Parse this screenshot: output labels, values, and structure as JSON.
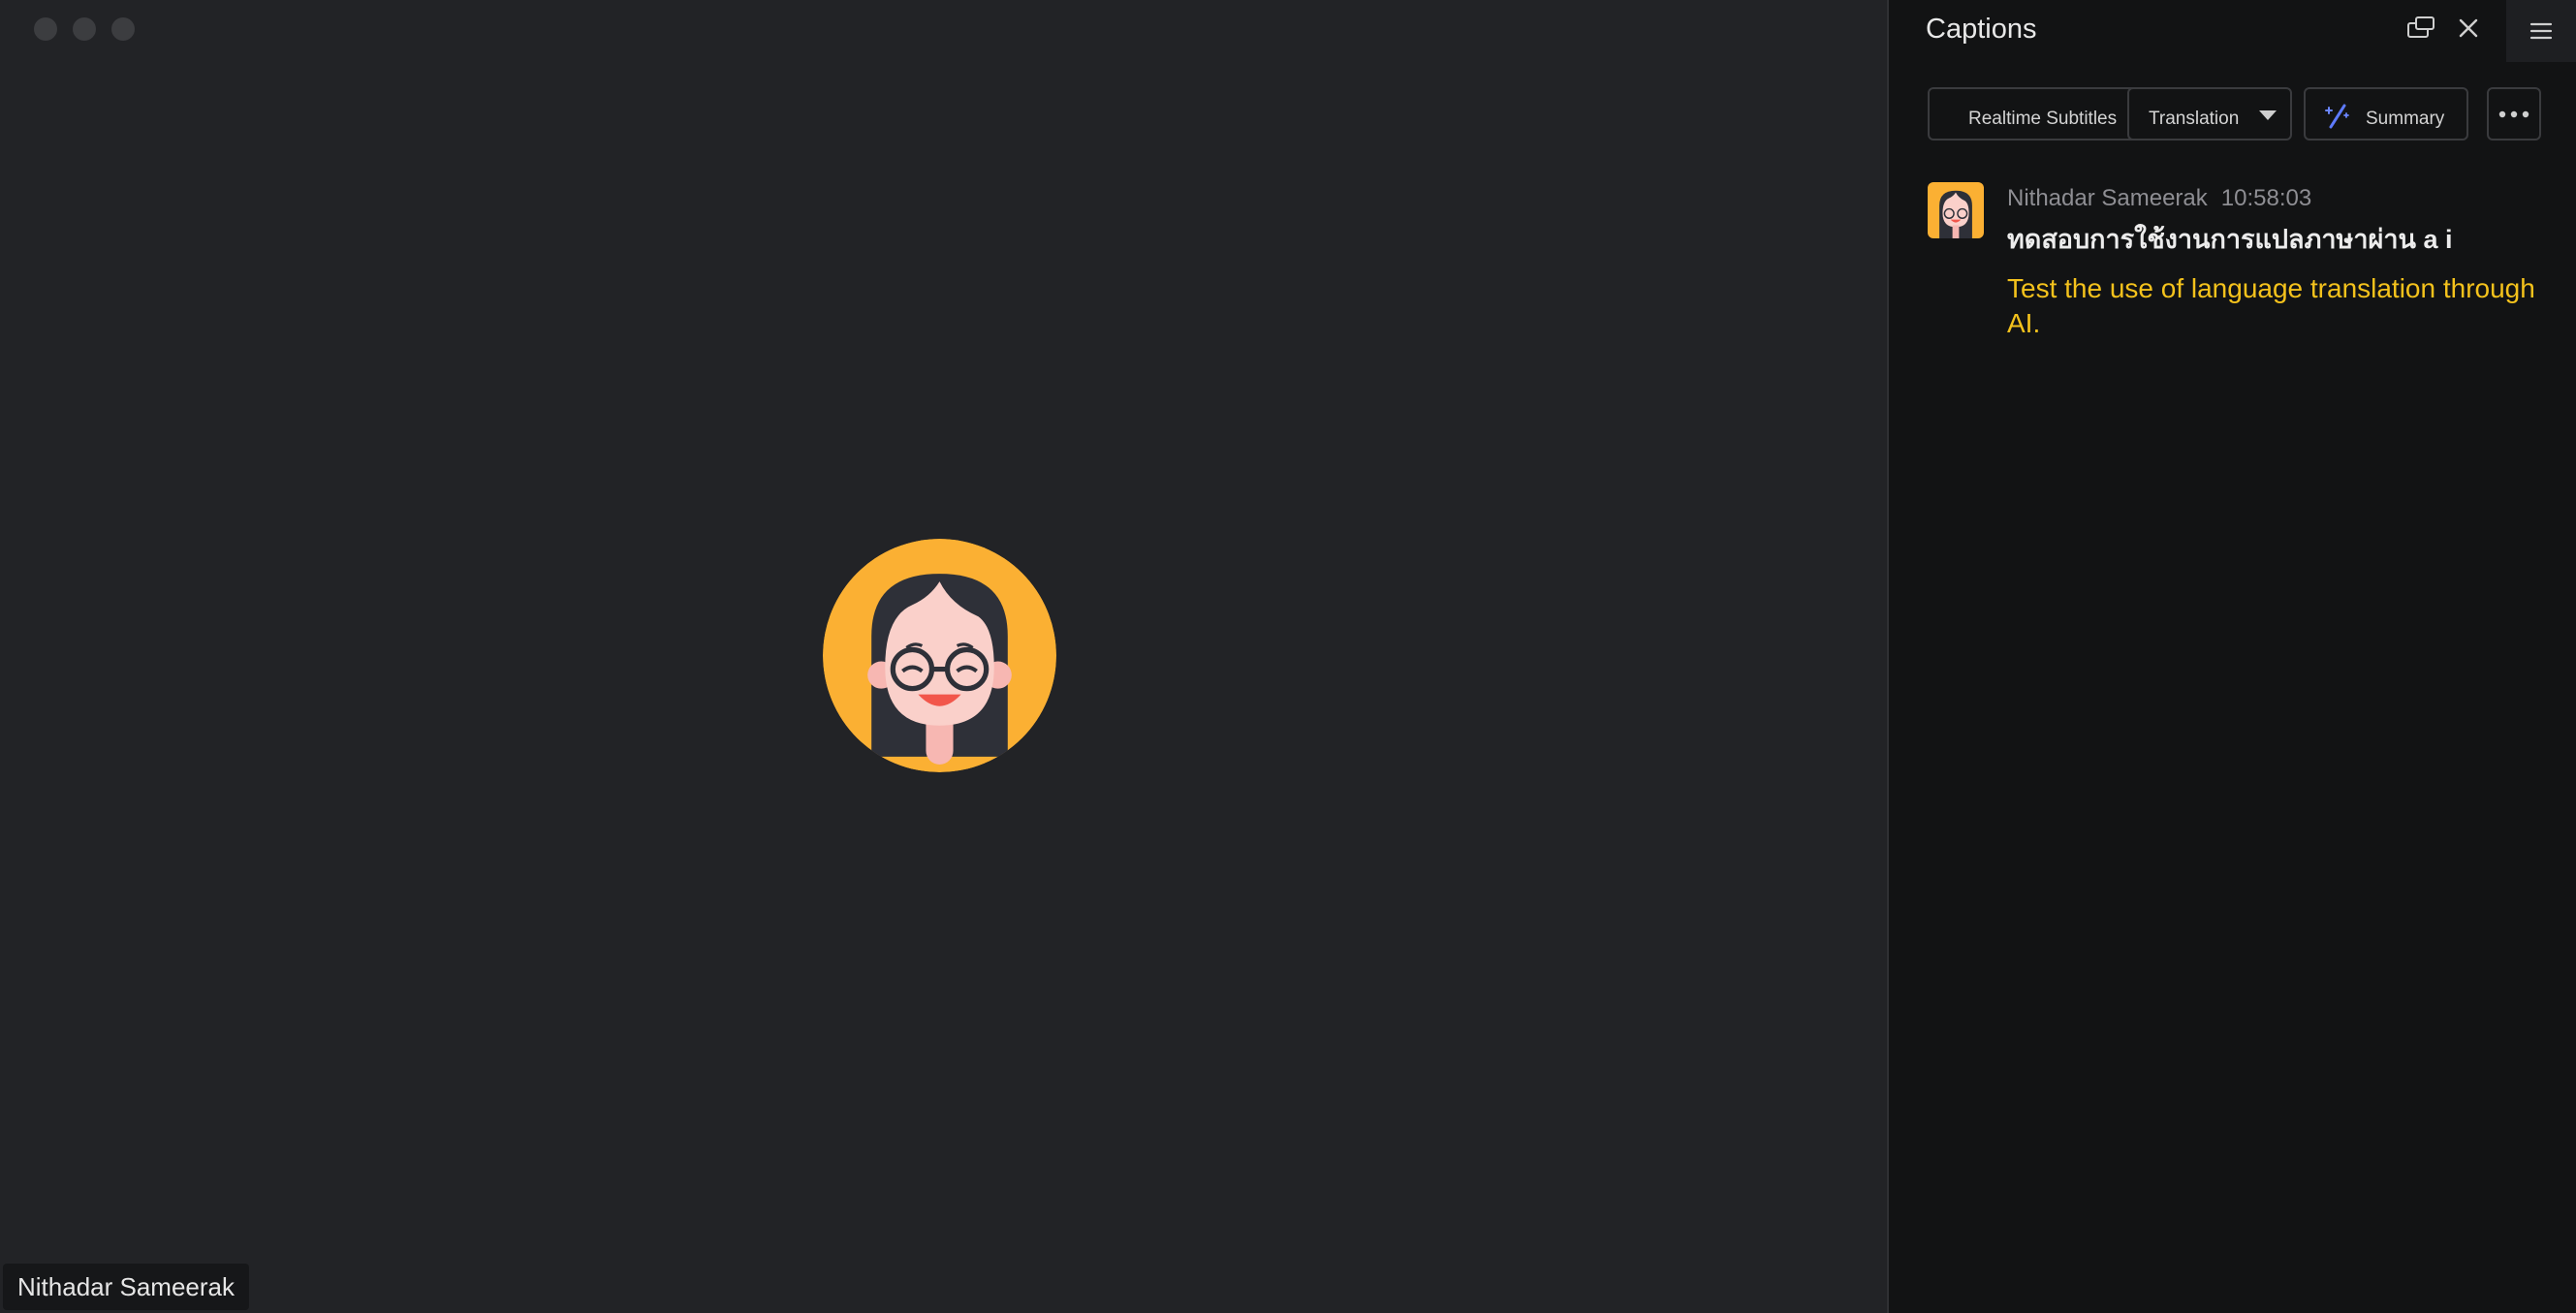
{
  "window": {
    "controls": [
      "close",
      "minimize",
      "zoom"
    ]
  },
  "stage": {
    "participant_name": "Nithadar Sameerak",
    "avatar_icon": "avatar-girl-glasses-icon"
  },
  "panel": {
    "title": "Captions",
    "icons": {
      "popout": "popout-window-icon",
      "close": "close-icon",
      "menu": "hamburger-menu-icon"
    },
    "toolbar": {
      "realtime_subtitles_label": "Realtime Subtitles",
      "translation_label": "Translation",
      "summary_label": "Summary",
      "summary_icon": "magic-wand-icon",
      "more_icon": "more-dots-icon"
    },
    "messages": [
      {
        "speaker": "Nithadar Sameerak",
        "time": "10:58:03",
        "original": "ทดสอบการใช้งานการแปลภาษาผ่าน a i",
        "translation": "Test the use of language translation through AI."
      }
    ]
  },
  "colors": {
    "avatar_bg": "#FBB033",
    "translation_text": "#F4C21C",
    "panel_bg": "#121314",
    "stage_bg": "#222326"
  }
}
